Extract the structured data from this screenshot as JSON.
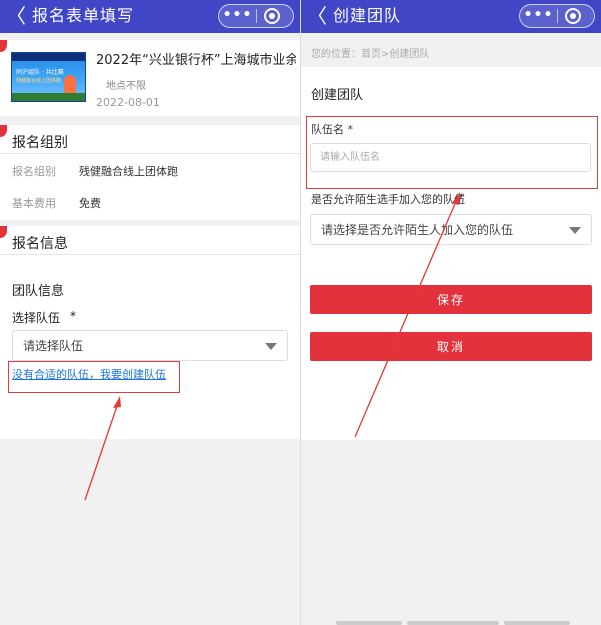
{
  "left": {
    "nav": {
      "back": "〈",
      "title": "报名表单填写",
      "capsule_dots": "•••"
    },
    "event": {
      "title": "2022年“兴业银行杯”上海城市业余",
      "location": "地点不限",
      "date": "2022-08-01",
      "thumb_line1": "同沪组队 · 共比赛",
      "thumb_line2": "残健融合线上团体跑"
    },
    "group_section": {
      "title": "报名组别",
      "rows": [
        {
          "label": "报名组别",
          "value": "残健融合线上团体跑"
        },
        {
          "label": "基本费用",
          "value": "免费"
        }
      ]
    },
    "info_section": {
      "title": "报名信息",
      "team_info_title": "团队信息",
      "select_team_label": "选择队伍",
      "required_mark": "*",
      "select_placeholder": "请选择队伍",
      "create_link": "没有合适的队伍，我要创建队伍"
    }
  },
  "right": {
    "nav": {
      "back": "〈",
      "title": "创建团队",
      "capsule_dots": "•••"
    },
    "breadcrumb": "您的位置：首页>创建团队",
    "page_title": "创建团队",
    "team_name_label": "队伍名 *",
    "team_name_placeholder": "请输入队伍名",
    "allow_strangers_label": "是否允许陌生选手加入您的队伍",
    "required_mark": "*",
    "allow_strangers_placeholder": "请选择是否允许陌生人加入您的队伍",
    "save_label": "保存",
    "cancel_label": "取消"
  },
  "colors": {
    "nav_bg": "#4146c6",
    "accent_red": "#e3323b",
    "annotation_red": "#e53935",
    "link_blue": "#1a73e8"
  }
}
